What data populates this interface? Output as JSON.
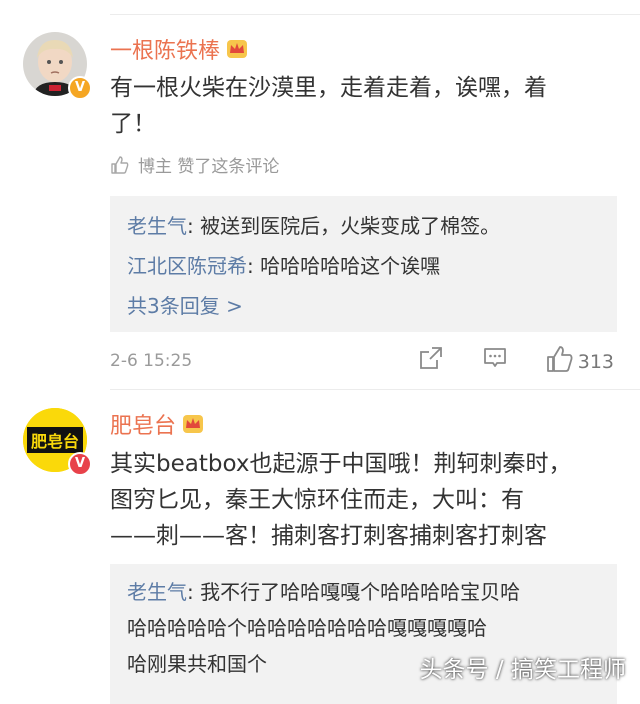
{
  "comments": [
    {
      "username": "一根陈铁棒",
      "text_line1": "有一根火柴在沙漠里，走着走着，诶嘿，着",
      "text_line2": "了！",
      "liked_by_author": "博主 赞了这条评论",
      "replies": [
        {
          "name": "老生气",
          "text": "被送到医院后，火柴变成了棉签。"
        },
        {
          "name": "江北区陈冠希",
          "text": "哈哈哈哈哈这个诶嘿"
        }
      ],
      "more_replies": "共3条回复 >",
      "timestamp": "2-6 15:25",
      "like_count": "313"
    },
    {
      "username": "肥皂台",
      "avatar_text": "肥皂台",
      "text_line1": "其实beatbox也起源于中国哦！荆轲刺秦时，",
      "text_line2": "图穷匕见，秦王大惊环住而走，大叫：有",
      "text_line3": "——刺——客！捕刺客打刺客捕刺客打刺客",
      "replies": [
        {
          "name": "老生气",
          "text": "我不行了哈哈嘎嘎个哈哈哈哈宝贝哈"
        }
      ],
      "reply_line2": "哈哈哈哈哈个哈哈哈哈哈哈哈嘎嘎嘎嘎哈",
      "reply_line3": "哈刚果共和国个"
    }
  ],
  "watermark": "头条号 / 搞笑工程师",
  "colors": {
    "username": "#eb7350",
    "link": "#5d7ca6",
    "verified": "#f5a623",
    "reply_bg": "#f2f2f2"
  }
}
